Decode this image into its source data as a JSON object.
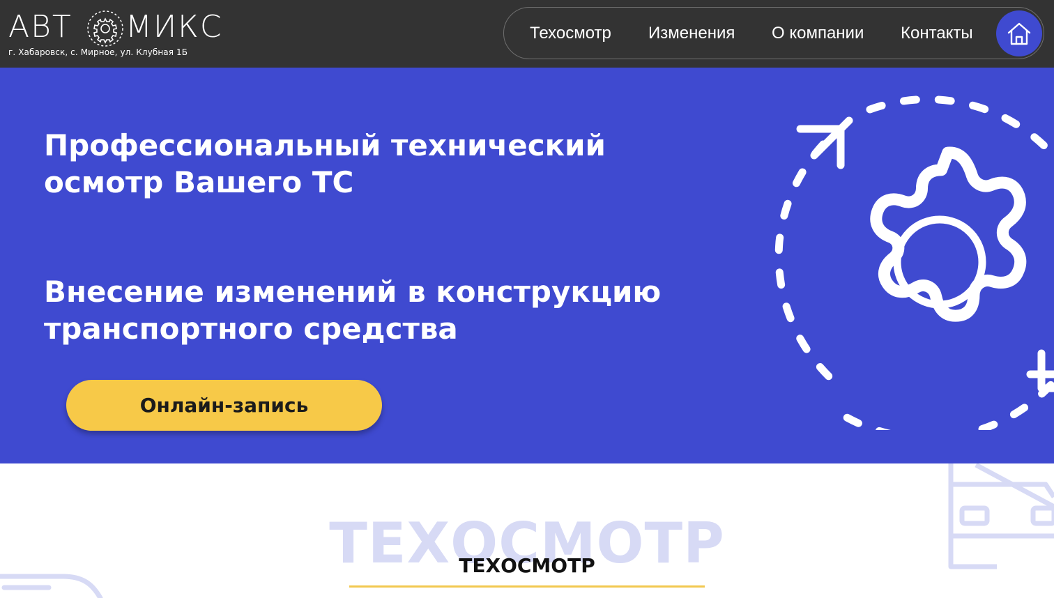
{
  "header": {
    "logo": {
      "left_text": "АВТ",
      "right_text": "МИКС",
      "address": "г. Хабаровск, с. Мирное, ул. Клубная 1Б"
    },
    "nav": [
      {
        "label": "Техосмотр"
      },
      {
        "label": "Изменения"
      },
      {
        "label": "О компании"
      },
      {
        "label": "Контакты"
      }
    ],
    "home_icon": "home-icon"
  },
  "hero": {
    "title_1": "Профессиональный технический осмотр Вашего ТС",
    "title_2": "Внесение изменений в конструкцию транспортного средства",
    "cta_label": "Онлайн-запись",
    "icon": "gear-cycle-icon"
  },
  "section": {
    "background_title": "ТЕХОСМОТР",
    "title": "ТЕХОСМОТР"
  },
  "colors": {
    "header_bg": "#333333",
    "hero_bg": "#3f4ad0",
    "accent_yellow": "#f7c948",
    "light_violet": "#d7daf5"
  }
}
